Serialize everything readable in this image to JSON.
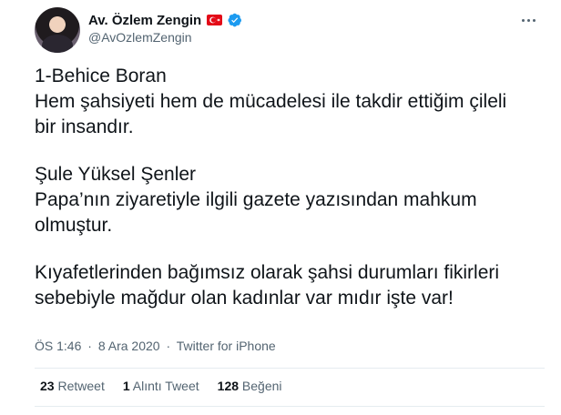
{
  "author": {
    "display_name": "Av. Özlem Zengin",
    "handle": "@AvOzlemZengin",
    "flag_icon": "turkey-flag-icon",
    "verified_icon": "verified-badge-icon"
  },
  "tweet": {
    "paragraphs": [
      [
        "1-Behice Boran",
        "Hem şahsiyeti hem de mücadelesi ile takdir ettiğim çileli",
        "bir insandır."
      ],
      [
        "Şule Yüksel Şenler",
        "Papa’nın ziyaretiyle ilgili gazete yazısından mahkum",
        "olmuştur."
      ],
      [
        "Kıyafetlerinden bağımsız olarak şahsi durumları fikirleri",
        "sebebiyle  mağdur olan kadınlar var mıdır işte var!"
      ]
    ],
    "time": "ÖS 1:46",
    "date": "8 Ara 2020",
    "source": "Twitter for iPhone",
    "separator": "·"
  },
  "stats": {
    "retweets": {
      "count": "23",
      "label": "Retweet"
    },
    "quotes": {
      "count": "1",
      "label": "Alıntı Tweet"
    },
    "likes": {
      "count": "128",
      "label": "Beğeni"
    }
  },
  "colors": {
    "text": "#0f1419",
    "secondary": "#536471",
    "verified": "#1d9bf0",
    "flag_red": "#e30a17",
    "divider": "#e6ecf0"
  }
}
